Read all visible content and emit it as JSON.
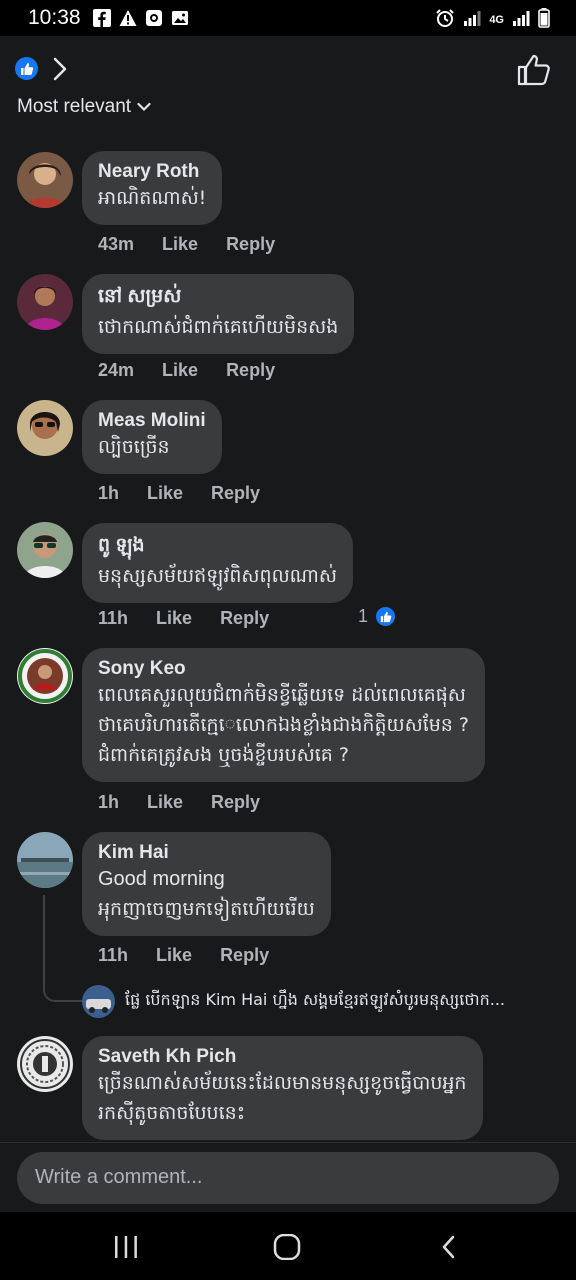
{
  "status_bar": {
    "time": "10:38",
    "network": "4G"
  },
  "header": {
    "sort_label": "Most relevant"
  },
  "comments": [
    {
      "author": "Neary Roth",
      "lines": [
        "អាណិតណាស់!"
      ],
      "time": "43m",
      "like": "Like",
      "reply": "Reply"
    },
    {
      "author": "នៅ សម្រស់",
      "lines": [
        "ថោកណាស់ជំពាក់គេហើយមិនសង"
      ],
      "time": "24m",
      "like": "Like",
      "reply": "Reply"
    },
    {
      "author": "Meas Molini",
      "lines": [
        "ល្បិចច្រើន"
      ],
      "time": "1h",
      "like": "Like",
      "reply": "Reply"
    },
    {
      "author": "ពូ ឡុង",
      "lines": [
        "មនុស្សសម័យឥឡូវពិសពុលណាស់"
      ],
      "time": "11h",
      "like": "Like",
      "reply": "Reply",
      "reactions": "1"
    },
    {
      "author": "Sony  Keo",
      "lines": [
        "ពេលគេសួរលុយជំពាក់មិនខ្វីឆ្លើយទេ ដល់ពេលគេផុស",
        "ថាគេបរិហារតើកេ្មេលោកឯងខ្លាំងជាងកិត្តិយសមែន ?",
        "ជំពាក់គេត្រូវសង ឬចង់ខ្ចីបរបស់គេ ?"
      ],
      "time": "1h",
      "like": "Like",
      "reply": "Reply"
    },
    {
      "author": "Kim Hai",
      "lines": [
        "Good morning",
        "អុកញាចេញមកទៀតហើយរើយ"
      ],
      "time": "11h",
      "like": "Like",
      "reply": "Reply"
    },
    {
      "author": "Saveth Kh Pich",
      "lines": [
        "ច្រើនណាស់សម័យនេះដែលមានមនុស្សខូចធ្វើបាបអ្នក",
        "រកស៊ីតូចតាចបែបនេះ"
      ]
    }
  ],
  "reply_preview": {
    "text": "ផ្លែ បើកឡាន Kim Hai ហ្នឹង សង្គមខ្មែរឥឡូវសំបូរមនុស្សថោក..."
  },
  "composer": {
    "placeholder": "Write a comment..."
  },
  "colors": {
    "accent": "#1877f2",
    "bubble": "#3a3b3c",
    "background": "#18191a",
    "meta": "#b0b3b8"
  }
}
